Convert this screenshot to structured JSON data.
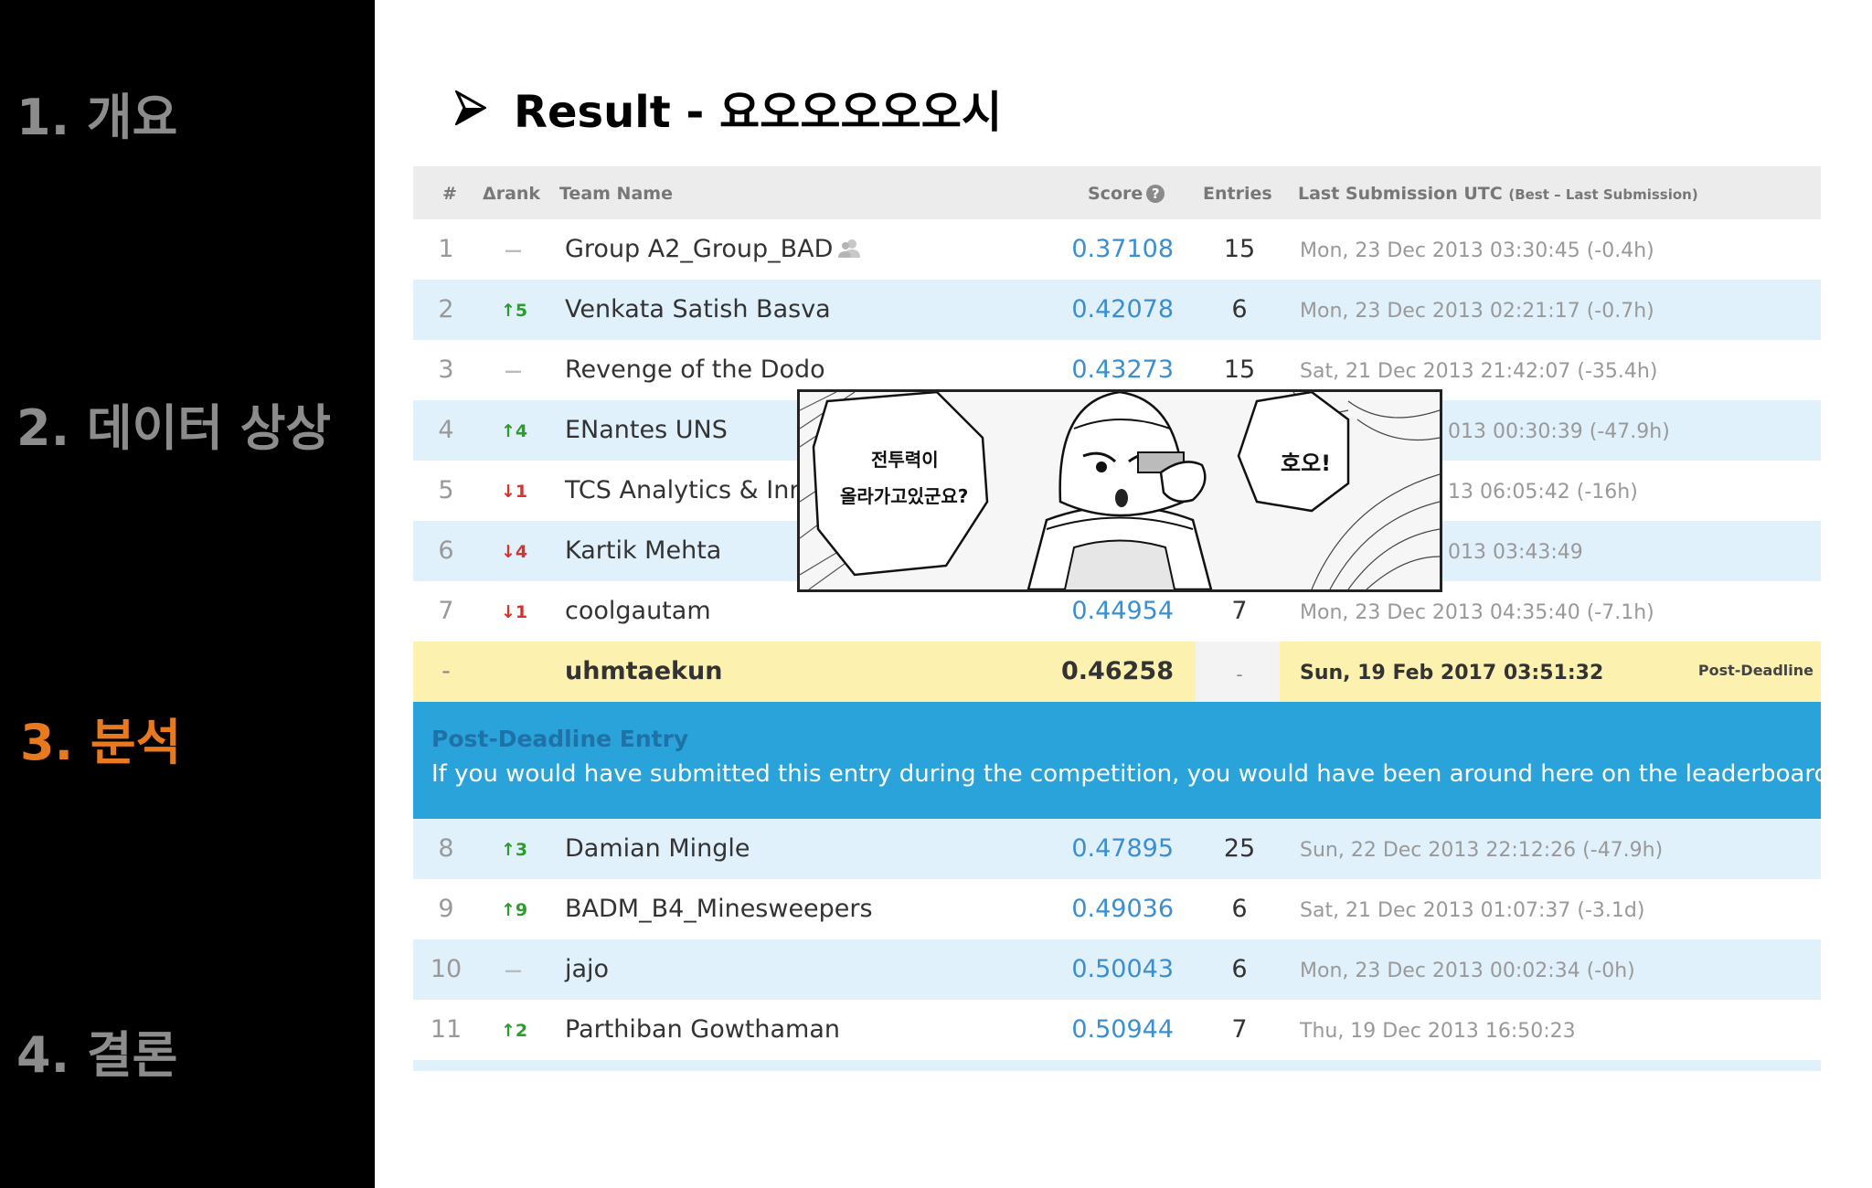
{
  "nav": [
    {
      "label": "1. 개요",
      "active": false
    },
    {
      "label": "2. 데이터 상상",
      "active": false
    },
    {
      "label": "3. 분석",
      "active": true
    },
    {
      "label": "4. 결론",
      "active": false
    }
  ],
  "title": "Result - 요오오오오오시",
  "table": {
    "headers": {
      "rank": "#",
      "delta": "Δrank",
      "team": "Team Name",
      "score": "Score",
      "entries": "Entries",
      "last": "Last Submission UTC",
      "last_note": "(Best – Last Submission)"
    },
    "rows": [
      {
        "rank": "1",
        "delta": "—",
        "team": "Group A2_Group_BAD",
        "score": "0.37108",
        "entries": "15",
        "last": "Mon, 23 Dec 2013 03:30:45 (-0.4h)"
      },
      {
        "rank": "2",
        "delta": "↑5",
        "team": "Venkata Satish Basva",
        "score": "0.42078",
        "entries": "6",
        "last": "Mon, 23 Dec 2013 02:21:17 (-0.7h)"
      },
      {
        "rank": "3",
        "delta": "—",
        "team": "Revenge of the Dodo",
        "score": "0.43273",
        "entries": "15",
        "last": "Sat, 21 Dec 2013 21:42:07 (-35.4h)"
      },
      {
        "rank": "4",
        "delta": "↑4",
        "team": "ENantes UNS",
        "score": "",
        "entries": "",
        "last": "013 00:30:39 (-47.9h)"
      },
      {
        "rank": "5",
        "delta": "↓1",
        "team": "TCS Analytics & Inno",
        "score": "",
        "entries": "",
        "last": "13 06:05:42 (-16h)"
      },
      {
        "rank": "6",
        "delta": "↓4",
        "team": "Kartik Mehta",
        "score": "",
        "entries": "",
        "last": "013 03:43:49"
      },
      {
        "rank": "7",
        "delta": "↓1",
        "team": "coolgautam",
        "score": "0.44954",
        "entries": "7",
        "last": "Mon, 23 Dec 2013 04:35:40 (-7.1h)"
      }
    ],
    "you": {
      "rank": "-",
      "team": "uhmtaekun",
      "score": "0.46258",
      "entries": "-",
      "last": "Sun, 19 Feb 2017 03:51:32",
      "tag": "Post-Deadline"
    },
    "notice": {
      "title": "Post-Deadline Entry",
      "body": "If you would have submitted this entry during the competition, you would have been around here on the leaderboard."
    },
    "rows_after": [
      {
        "rank": "8",
        "delta": "↑3",
        "team": "Damian Mingle",
        "score": "0.47895",
        "entries": "25",
        "last": "Sun, 22 Dec 2013 22:12:26 (-47.9h)"
      },
      {
        "rank": "9",
        "delta": "↑9",
        "team": "BADM_B4_Minesweepers",
        "score": "0.49036",
        "entries": "6",
        "last": "Sat, 21 Dec 2013 01:07:37 (-3.1d)"
      },
      {
        "rank": "10",
        "delta": "—",
        "team": "jajo",
        "score": "0.50043",
        "entries": "6",
        "last": "Mon, 23 Dec 2013 00:02:34 (-0h)"
      },
      {
        "rank": "11",
        "delta": "↑2",
        "team": "Parthiban Gowthaman",
        "score": "0.50944",
        "entries": "7",
        "last": "Thu, 19 Dec 2013 16:50:23"
      }
    ]
  },
  "manga": {
    "bubble_left_line1": "전투력이",
    "bubble_left_line2": "올라가고있군요?",
    "bubble_right": "호오!"
  },
  "colors": {
    "sidebar_bg": "#000000",
    "nav_inactive": "#8c8c8c",
    "nav_active": "#e8791e",
    "score_blue": "#3a8fd1",
    "row_alt": "#e1f1fc",
    "you_row": "#fdf1b0",
    "notice_bg": "#2aa3da",
    "up": "#2e9b2e",
    "down": "#d8322e"
  },
  "icons": {
    "title_bullet": "arrowhead-bullet-icon",
    "score_help": "help-circle-icon",
    "team_members": "people-icon"
  }
}
